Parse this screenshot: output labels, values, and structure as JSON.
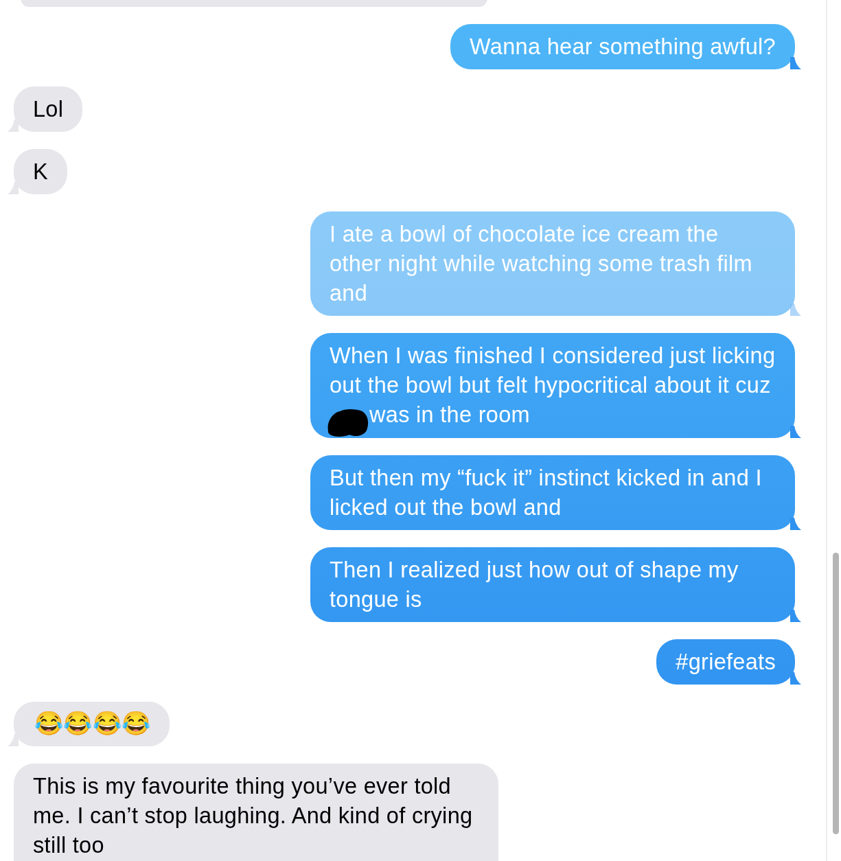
{
  "messages": [
    {
      "sent": false,
      "cut_top": true
    },
    {
      "sent": true,
      "text": "Wanna hear something awful?",
      "faded": false
    },
    {
      "sent": false,
      "text": "Lol"
    },
    {
      "sent": false,
      "text": "K"
    },
    {
      "sent": true,
      "text": "I ate a bowl of chocolate ice cream the other night while watching some trash film and",
      "faded": true
    },
    {
      "sent": true,
      "text": "When I was finished I considered just licking out the bowl but felt hypocritical about it cuz",
      "redacted": true,
      "text_after": "was in the room",
      "faded": false
    },
    {
      "sent": true,
      "text": "But then my “fuck it” instinct kicked in and I licked out the bowl and",
      "faded": false
    },
    {
      "sent": true,
      "text": "Then I realized just how out of shape my tongue is",
      "faded": false
    },
    {
      "sent": true,
      "text": "#griefeats",
      "faded": false
    },
    {
      "sent": false,
      "text": "😂😂😂😂",
      "kind": "emoji"
    },
    {
      "sent": false,
      "text": "This is my favourite thing you’ve ever told me. I can’t stop laughing. And kind of crying still too",
      "cut_bottom": true
    }
  ]
}
